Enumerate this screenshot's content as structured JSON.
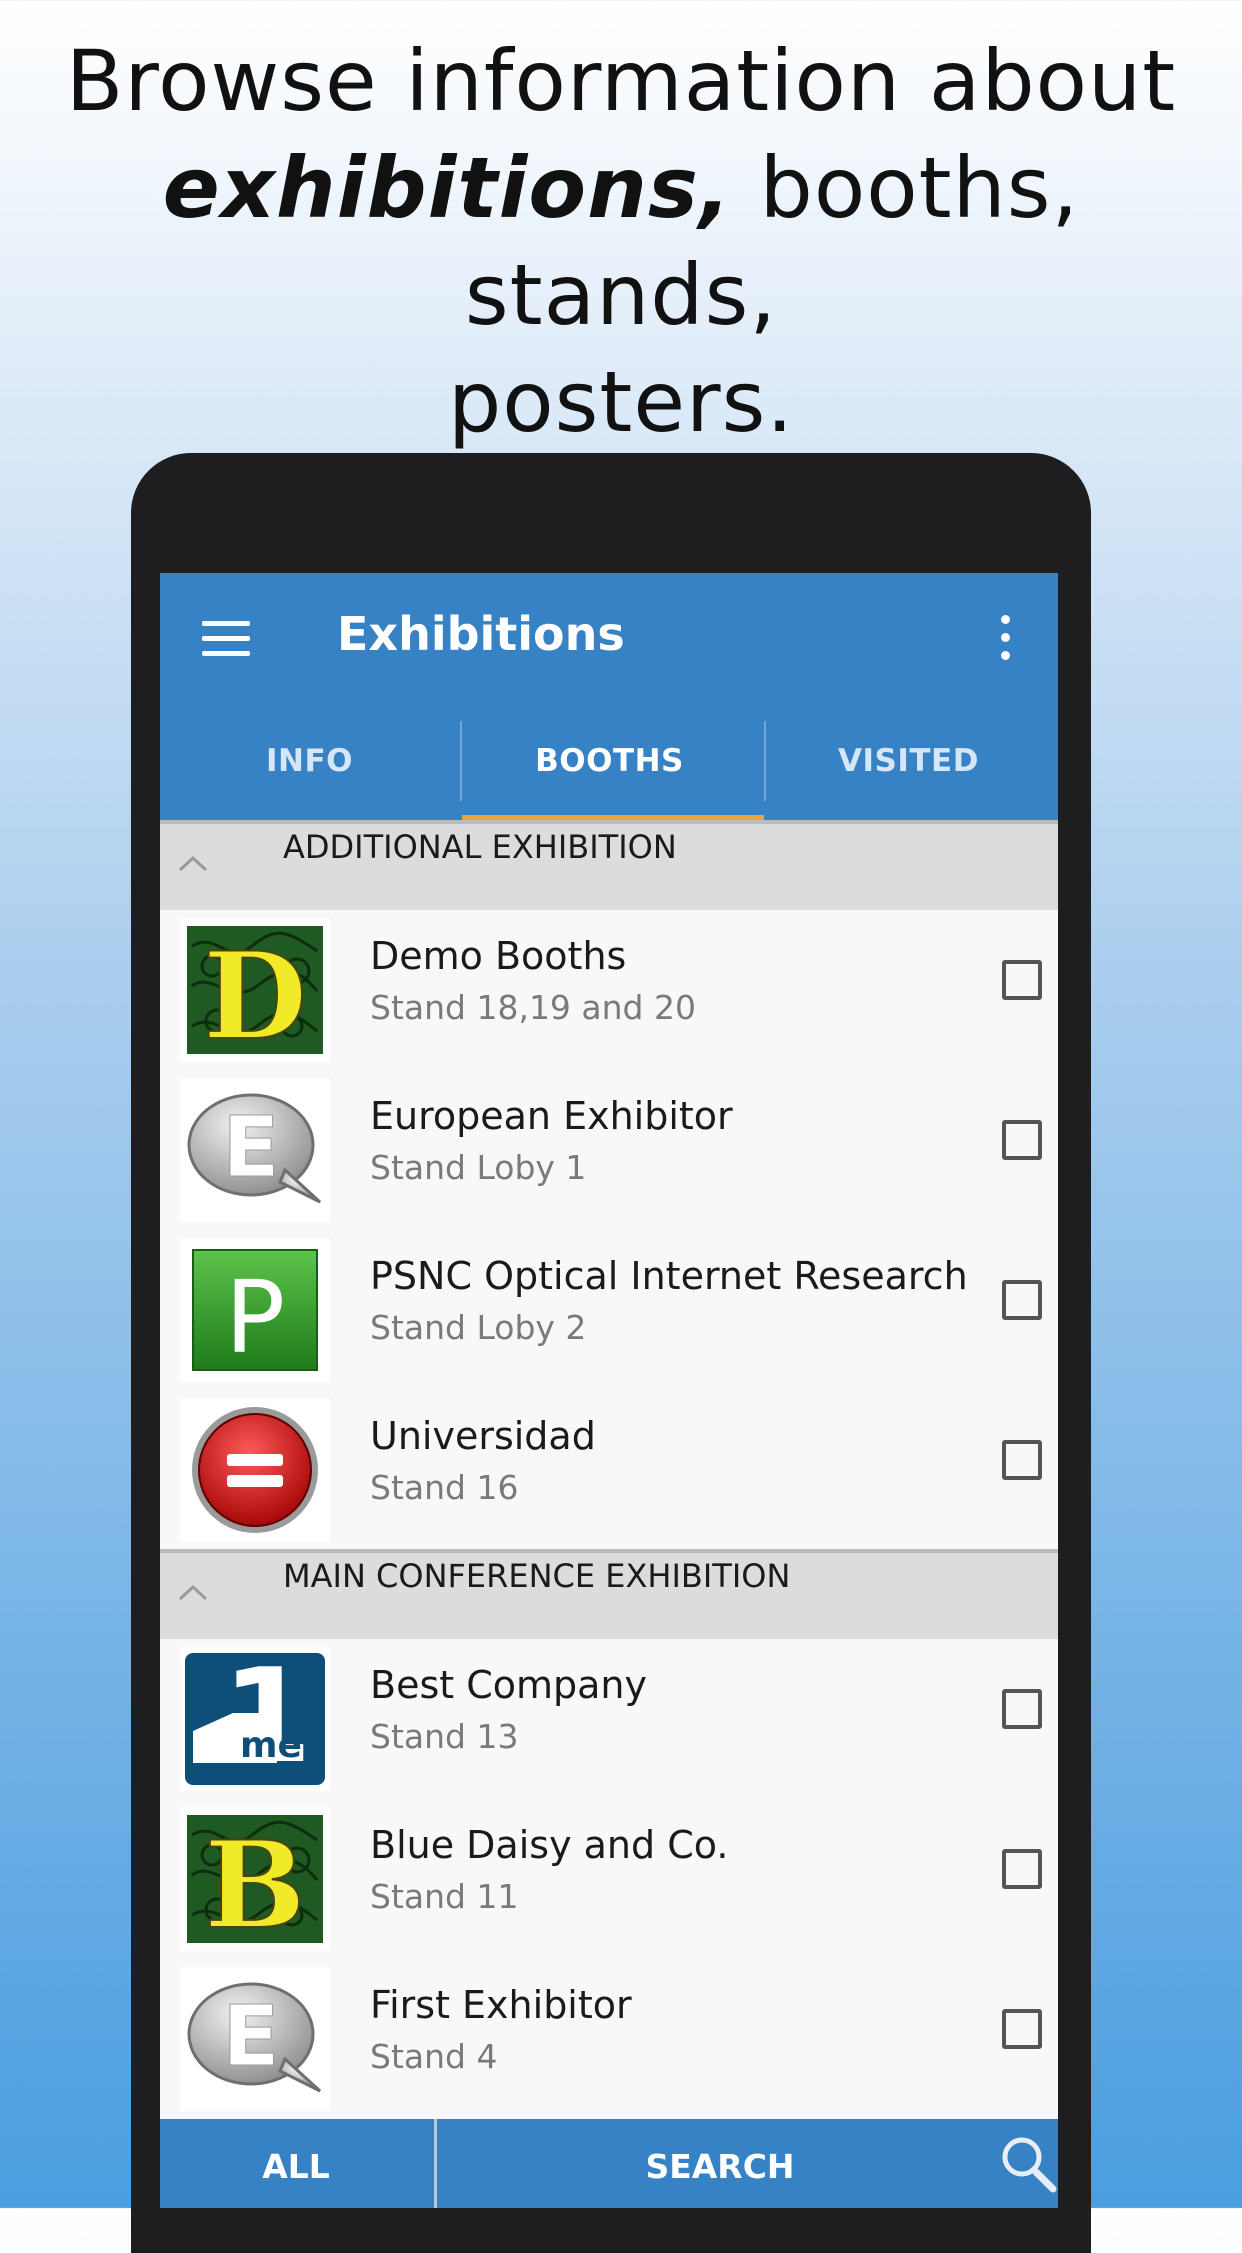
{
  "headline": {
    "line1": "Browse information about",
    "line2_em": "exhibitions,",
    "line2_rest": " booths, stands,",
    "line3": "posters."
  },
  "app": {
    "title": "Exhibitions",
    "menu_icon": "hamburger-menu-icon",
    "overflow_icon": "more-vertical-icon"
  },
  "tabs": [
    {
      "label": "INFO"
    },
    {
      "label": "BOOTHS",
      "active": true
    },
    {
      "label": "VISITED"
    }
  ],
  "colors": {
    "appbar": "#3682c4",
    "tab_indicator": "#f2a23a",
    "section_bg": "#dcdcde"
  },
  "sections": [
    {
      "label": "ADDITIONAL EXHIBITION",
      "items": [
        {
          "name": "Demo Booths",
          "stand": "Stand 18,19 and 20",
          "logo": "ornate-letter-D-logo",
          "checked": false
        },
        {
          "name": "European Exhibitor",
          "stand": "Stand Loby 1",
          "logo": "speech-bubble-E-logo",
          "checked": false
        },
        {
          "name": "PSNC Optical Internet Research",
          "stand": "Stand Loby 2",
          "logo": "green-P-logo",
          "checked": false
        },
        {
          "name": "Universidad",
          "stand": "Stand 16",
          "logo": "red-circle-equals-logo",
          "checked": false
        }
      ]
    },
    {
      "label": "MAIN CONFERENCE EXHIBITION",
      "items": [
        {
          "name": "Best Company",
          "stand": "Stand 13",
          "logo": "4me-logo",
          "checked": false
        },
        {
          "name": "Blue Daisy and Co.",
          "stand": "Stand 11",
          "logo": "ornate-letter-B-logo",
          "checked": false
        },
        {
          "name": "First Exhibitor",
          "stand": "Stand 4",
          "logo": "speech-bubble-E-logo",
          "checked": false
        }
      ]
    }
  ],
  "bottom_bar": {
    "all_label": "ALL",
    "search_label": "SEARCH",
    "search_icon": "magnifier-icon"
  },
  "logo_text": {
    "D": "D",
    "E": "E",
    "P": "P",
    "B": "B",
    "one": "1",
    "me": "me"
  }
}
